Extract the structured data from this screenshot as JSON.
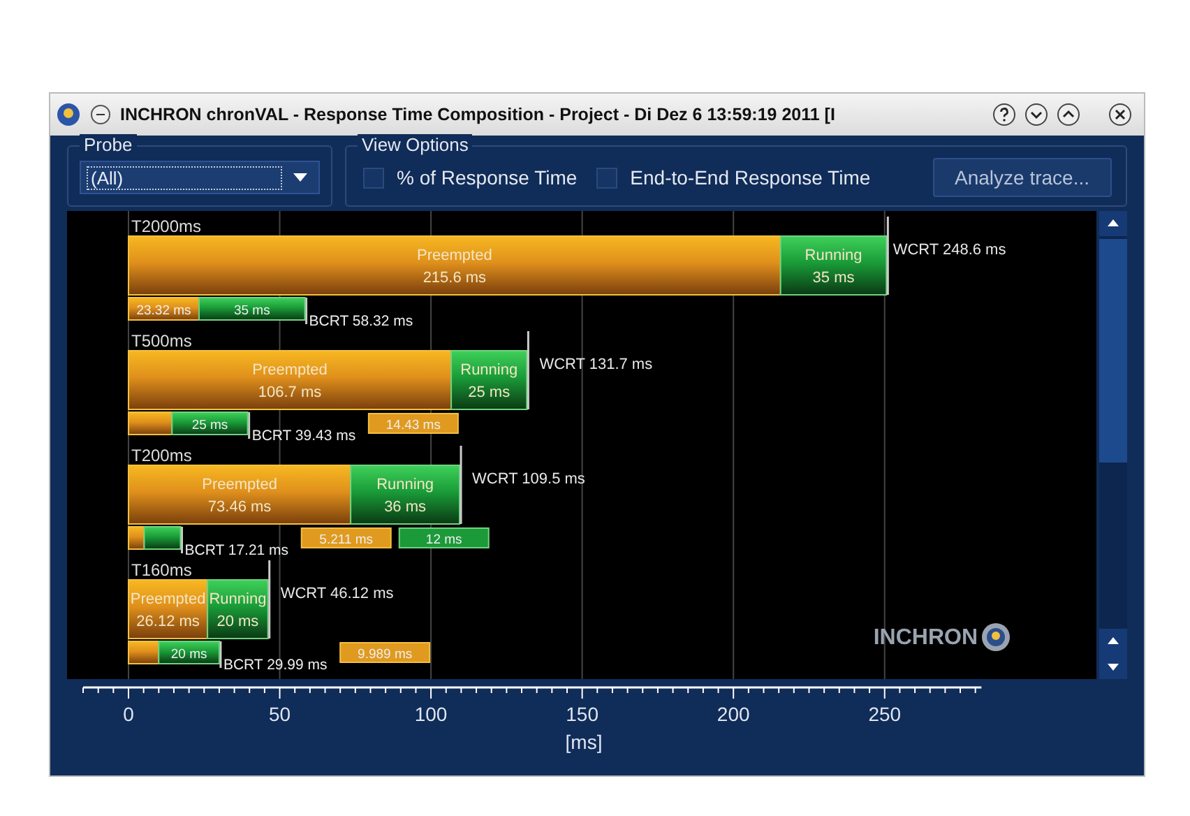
{
  "window": {
    "title": "INCHRON chronVAL - Response Time Composition - Project - Di Dez 6 13:59:19 2011 [I"
  },
  "probe": {
    "label": "Probe",
    "value": "(All)"
  },
  "view_options": {
    "label": "View Options",
    "checkboxes": [
      {
        "label": "% of Response Time",
        "checked": false
      },
      {
        "label": "End-to-End Response Time",
        "checked": false
      }
    ],
    "button": "Analyze trace..."
  },
  "chart": {
    "logo": "INCHRON",
    "value_box_rows": [
      {
        "boxes": [
          {
            "text": "14.43 ms",
            "kind": "preempted"
          }
        ]
      },
      {
        "boxes": [
          {
            "text": "5.211 ms",
            "kind": "preempted"
          },
          {
            "text": "12 ms",
            "kind": "running"
          }
        ]
      },
      {
        "boxes": [
          {
            "text": "9.989 ms",
            "kind": "preempted"
          }
        ]
      }
    ],
    "chart_data": {
      "type": "bar",
      "orientation": "horizontal",
      "stacked": true,
      "grid": true,
      "xlabel": "[ms]",
      "xlim": [
        -15,
        282
      ],
      "xticks": [
        0,
        50,
        100,
        150,
        200,
        250
      ],
      "categories": [
        "T2000ms",
        "BCRT 58.32 ms",
        "T500ms",
        "BCRT 39.43 ms",
        "T200ms",
        "BCRT 17.21 ms",
        "T160ms",
        "BCRT 29.99 ms"
      ],
      "series": [
        {
          "name": "Preempted",
          "values": [
            215.6,
            23.32,
            106.7,
            14.4,
            73.46,
            5.2,
            26.12,
            10
          ],
          "value_labels": [
            "215.6 ms",
            "23.32 ms",
            "106.7 ms",
            null,
            "73.46 ms",
            null,
            "26.12 ms",
            null
          ]
        },
        {
          "name": "Running",
          "values": [
            35,
            35,
            25,
            25,
            36,
            12,
            20,
            20
          ],
          "value_labels": [
            "35 ms",
            "35 ms",
            "25 ms",
            "25 ms",
            "36 ms",
            null,
            "20 ms",
            "20 ms"
          ]
        }
      ],
      "annotations": [
        {
          "text": "WCRT 248.6 ms",
          "x": 248.6,
          "y": "T2000ms"
        },
        {
          "text": "WCRT 131.7 ms",
          "x": 131.7,
          "y": "T500ms"
        },
        {
          "text": "WCRT 109.5 ms",
          "x": 109.46,
          "y": "T200ms"
        },
        {
          "text": "WCRT 46.12 ms",
          "x": 46.12,
          "y": "T160ms"
        }
      ]
    }
  }
}
